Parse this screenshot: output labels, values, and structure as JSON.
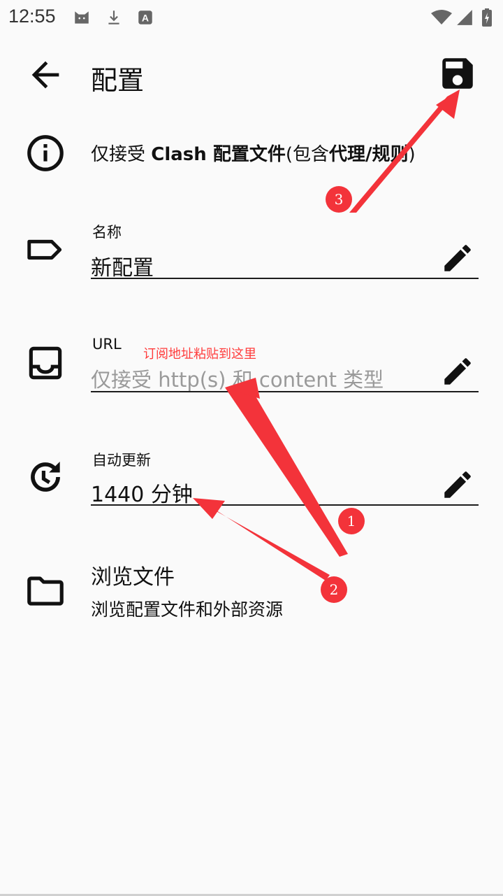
{
  "status_bar": {
    "time": "12:55",
    "left_icons": [
      "cat-icon",
      "download-icon",
      "a-badge-icon"
    ],
    "right_icons": [
      "wifi-icon",
      "signal-icon",
      "battery-charging-icon"
    ]
  },
  "app_bar": {
    "title": "配置",
    "back_icon": "arrow-back-icon",
    "save_icon": "save-icon"
  },
  "info": {
    "prefix": "仅接受 ",
    "bold_1": "Clash 配置文件",
    "middle": "(包含",
    "bold_2": "代理/规则",
    "suffix": ")"
  },
  "fields": {
    "name": {
      "label": "名称",
      "value": "新配置"
    },
    "url": {
      "label": "URL",
      "placeholder": "仅接受 http(s) 和 content 类型"
    },
    "auto_update": {
      "label": "自动更新",
      "value": "1440 分钟"
    }
  },
  "browse": {
    "title": "浏览文件",
    "subtitle": "浏览配置文件和外部资源"
  },
  "annotations": {
    "url_hint": "订阅地址粘贴到这里",
    "badge_1": "1",
    "badge_2": "2",
    "badge_3": "3",
    "color": "#f3333a"
  }
}
